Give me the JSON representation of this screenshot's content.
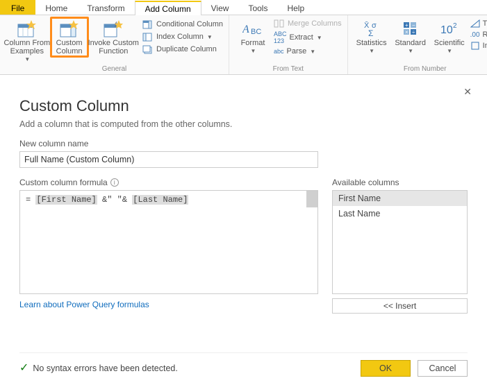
{
  "tabs": {
    "file": "File",
    "home": "Home",
    "transform": "Transform",
    "add_column": "Add Column",
    "view": "View",
    "tools": "Tools",
    "help": "Help"
  },
  "ribbon": {
    "general": {
      "label": "General",
      "col_from_examples": "Column From\nExamples",
      "custom_column": "Custom\nColumn",
      "invoke_fn": "Invoke Custom\nFunction",
      "conditional": "Conditional Column",
      "index": "Index Column",
      "duplicate": "Duplicate Column"
    },
    "from_text": {
      "label": "From Text",
      "format": "Format",
      "merge": "Merge Columns",
      "extract": "Extract",
      "parse": "Parse"
    },
    "from_number": {
      "label": "From Number",
      "statistics": "Statistics",
      "standard": "Standard",
      "scientific": "Scientific",
      "trig": "Trig",
      "rounding": "Rou",
      "info": "Info"
    }
  },
  "dialog": {
    "title": "Custom Column",
    "subtitle": "Add a column that is computed from the other columns.",
    "new_col_label": "New column name",
    "new_col_value": "Full Name (Custom Column)",
    "formula_label": "Custom column formula",
    "formula_prefix": "= ",
    "formula_h1": "[First Name]",
    "formula_mid": " &\" \"& ",
    "formula_h2": "[Last Name]",
    "available_label": "Available columns",
    "available": [
      "First Name",
      "Last Name"
    ],
    "insert": "<< Insert",
    "learn_link": "Learn about Power Query formulas",
    "status": "No syntax errors have been detected.",
    "ok": "OK",
    "cancel": "Cancel"
  }
}
